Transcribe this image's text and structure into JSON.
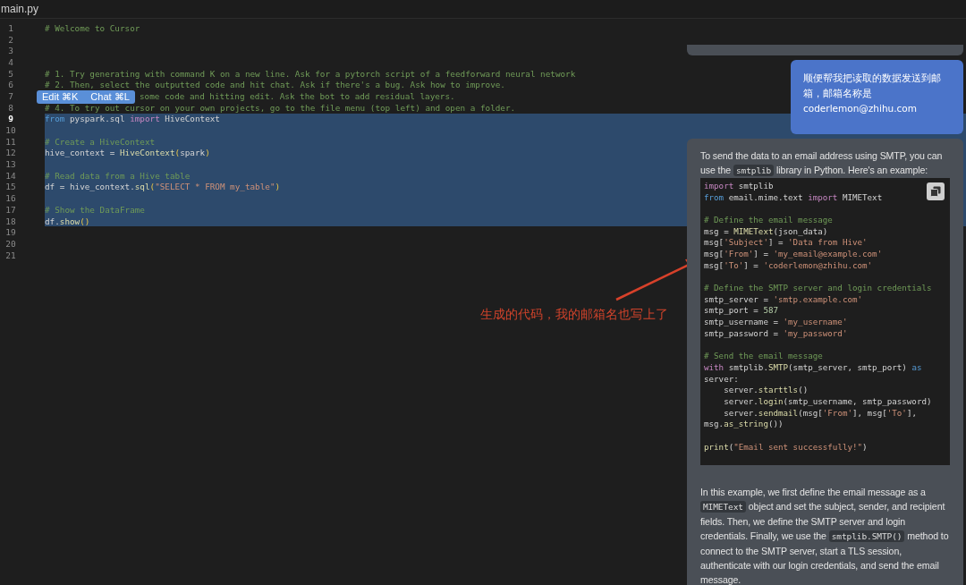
{
  "tab": {
    "title": "main.py"
  },
  "editor": {
    "lines": [
      {
        "number": "1",
        "current": false,
        "selected": false,
        "tokens": [
          {
            "text": "# Welcome to Cursor",
            "kind": "comment"
          }
        ]
      },
      {
        "number": "2",
        "current": false,
        "selected": false
      },
      {
        "number": "3",
        "current": false,
        "selected": false
      },
      {
        "number": "4",
        "current": false,
        "selected": false
      },
      {
        "number": "5",
        "current": false,
        "selected": false,
        "tokens": [
          {
            "text": "# 1. Try generating with command K on a new line. Ask for a pytorch script of a feedforward neural network",
            "kind": "comment"
          }
        ]
      },
      {
        "number": "6",
        "current": false,
        "selected": false,
        "tokens": [
          {
            "text": "# 2. Then, select the outputted code and hit chat. Ask if there's a bug. Ask how to improve.",
            "kind": "comment"
          }
        ]
      },
      {
        "number": "7",
        "current": false,
        "selected": false,
        "covered": true,
        "tokens": [
          {
            "text": "some code and hitting edit. Ask the bot to add residual layers.",
            "kind": "comment"
          }
        ]
      },
      {
        "number": "8",
        "current": false,
        "selected": false,
        "tokens": [
          {
            "text": "# 4. To try out cursor on your own projects, go to the file menu (top left) and open a folder.",
            "kind": "comment"
          }
        ]
      },
      {
        "number": "9",
        "current": true,
        "selected": true,
        "tokens": [
          {
            "text": "from ",
            "kind": "keyword2"
          },
          {
            "text": "pyspark.sql ",
            "kind": "plain"
          },
          {
            "text": "import ",
            "kind": "keyword"
          },
          {
            "text": "HiveContext",
            "kind": "plain"
          }
        ]
      },
      {
        "number": "10",
        "current": false,
        "selected": true
      },
      {
        "number": "11",
        "current": false,
        "selected": true,
        "tokens": [
          {
            "text": "# Create a HiveContext",
            "kind": "comment"
          }
        ]
      },
      {
        "number": "12",
        "current": false,
        "selected": true,
        "tokens": [
          {
            "text": "hive_context = ",
            "kind": "plain"
          },
          {
            "text": "HiveContext",
            "kind": "function"
          },
          {
            "text": "(",
            "kind": "paren"
          },
          {
            "text": "spark",
            "kind": "plain"
          },
          {
            "text": ")",
            "kind": "paren"
          }
        ]
      },
      {
        "number": "13",
        "current": false,
        "selected": true
      },
      {
        "number": "14",
        "current": false,
        "selected": true,
        "tokens": [
          {
            "text": "# Read data from a Hive table",
            "kind": "comment"
          }
        ]
      },
      {
        "number": "15",
        "current": false,
        "selected": true,
        "tokens": [
          {
            "text": "df = hive_context.",
            "kind": "plain"
          },
          {
            "text": "sql",
            "kind": "function"
          },
          {
            "text": "(",
            "kind": "paren"
          },
          {
            "text": "\"SELECT * FROM my_table\"",
            "kind": "string"
          },
          {
            "text": ")",
            "kind": "paren"
          }
        ]
      },
      {
        "number": "16",
        "current": false,
        "selected": true
      },
      {
        "number": "17",
        "current": false,
        "selected": true,
        "tokens": [
          {
            "text": "# Show the DataFrame",
            "kind": "comment"
          }
        ]
      },
      {
        "number": "18",
        "current": false,
        "selected": true,
        "tokens": [
          {
            "text": "df.",
            "kind": "plain"
          },
          {
            "text": "show",
            "kind": "function"
          },
          {
            "text": "()",
            "kind": "paren"
          }
        ]
      },
      {
        "number": "19",
        "current": false,
        "selected": false
      },
      {
        "number": "20",
        "current": false,
        "selected": false
      },
      {
        "number": "21",
        "current": false,
        "selected": false
      }
    ]
  },
  "popup": {
    "buttons": [
      "Edit ⌘K",
      "Chat ⌘L"
    ]
  },
  "annotation": {
    "text": "生成的代码，我的邮箱名也写上了"
  },
  "chat": {
    "user_message": "顺便帮我把读取的数据发送到邮箱，邮箱名称是coderlemon@zhihu.com",
    "reply_intro": [
      {
        "text": "To send the data to an email address using SMTP, you can use the ",
        "kind": "text"
      },
      {
        "text": "smtplib",
        "kind": "code"
      },
      {
        "text": " library in Python. Here's an example:",
        "kind": "text"
      }
    ],
    "code": [
      {
        "kind": "code",
        "tokens": [
          {
            "text": "import ",
            "kind": "keyword"
          },
          {
            "text": "smtplib",
            "kind": "plain"
          }
        ]
      },
      {
        "kind": "code",
        "tokens": [
          {
            "text": "from ",
            "kind": "keyword2"
          },
          {
            "text": "email.mime.text ",
            "kind": "plain"
          },
          {
            "text": "import ",
            "kind": "keyword"
          },
          {
            "text": "MIMEText",
            "kind": "plain"
          }
        ]
      },
      {
        "kind": "blank"
      },
      {
        "kind": "code",
        "tokens": [
          {
            "text": "# Define the email message",
            "kind": "comment"
          }
        ]
      },
      {
        "kind": "code",
        "tokens": [
          {
            "text": "msg = ",
            "kind": "plain"
          },
          {
            "text": "MIMEText",
            "kind": "function"
          },
          {
            "text": "(json_data)",
            "kind": "plain"
          }
        ]
      },
      {
        "kind": "code",
        "tokens": [
          {
            "text": "msg[",
            "kind": "plain"
          },
          {
            "text": "'Subject'",
            "kind": "string"
          },
          {
            "text": "] = ",
            "kind": "plain"
          },
          {
            "text": "'Data from Hive'",
            "kind": "string"
          }
        ]
      },
      {
        "kind": "code",
        "tokens": [
          {
            "text": "msg[",
            "kind": "plain"
          },
          {
            "text": "'From'",
            "kind": "string"
          },
          {
            "text": "] = ",
            "kind": "plain"
          },
          {
            "text": "'my_email@example.com'",
            "kind": "string"
          }
        ]
      },
      {
        "kind": "code",
        "tokens": [
          {
            "text": "msg[",
            "kind": "plain"
          },
          {
            "text": "'To'",
            "kind": "string"
          },
          {
            "text": "] = ",
            "kind": "plain"
          },
          {
            "text": "'coderlemon@zhihu.com'",
            "kind": "string"
          }
        ]
      },
      {
        "kind": "blank"
      },
      {
        "kind": "code",
        "tokens": [
          {
            "text": "# Define the SMTP server and login credentials",
            "kind": "comment"
          }
        ]
      },
      {
        "kind": "code",
        "tokens": [
          {
            "text": "smtp_server = ",
            "kind": "plain"
          },
          {
            "text": "'smtp.example.com'",
            "kind": "string"
          }
        ]
      },
      {
        "kind": "code",
        "tokens": [
          {
            "text": "smtp_port = ",
            "kind": "plain"
          },
          {
            "text": "587",
            "kind": "number"
          }
        ]
      },
      {
        "kind": "code",
        "tokens": [
          {
            "text": "smtp_username = ",
            "kind": "plain"
          },
          {
            "text": "'my_username'",
            "kind": "string"
          }
        ]
      },
      {
        "kind": "code",
        "tokens": [
          {
            "text": "smtp_password = ",
            "kind": "plain"
          },
          {
            "text": "'my_password'",
            "kind": "string"
          }
        ]
      },
      {
        "kind": "blank"
      },
      {
        "kind": "code",
        "tokens": [
          {
            "text": "# Send the email message",
            "kind": "comment"
          }
        ]
      },
      {
        "kind": "code",
        "tokens": [
          {
            "text": "with ",
            "kind": "keyword"
          },
          {
            "text": "smtplib.",
            "kind": "plain"
          },
          {
            "text": "SMTP",
            "kind": "function"
          },
          {
            "text": "(smtp_server, smtp_port) ",
            "kind": "plain"
          },
          {
            "text": "as",
            "kind": "keyword2"
          }
        ]
      },
      {
        "kind": "code",
        "tokens": [
          {
            "text": "server:",
            "kind": "plain"
          }
        ]
      },
      {
        "kind": "code",
        "tokens": [
          {
            "text": "    server.",
            "kind": "plain"
          },
          {
            "text": "starttls",
            "kind": "function"
          },
          {
            "text": "()",
            "kind": "plain"
          }
        ]
      },
      {
        "kind": "code",
        "tokens": [
          {
            "text": "    server.",
            "kind": "plain"
          },
          {
            "text": "login",
            "kind": "function"
          },
          {
            "text": "(smtp_username, smtp_password)",
            "kind": "plain"
          }
        ]
      },
      {
        "kind": "code",
        "tokens": [
          {
            "text": "    server.",
            "kind": "plain"
          },
          {
            "text": "sendmail",
            "kind": "function"
          },
          {
            "text": "(msg[",
            "kind": "plain"
          },
          {
            "text": "'From'",
            "kind": "string"
          },
          {
            "text": "], msg[",
            "kind": "plain"
          },
          {
            "text": "'To'",
            "kind": "string"
          },
          {
            "text": "],",
            "kind": "plain"
          }
        ]
      },
      {
        "kind": "code",
        "tokens": [
          {
            "text": "msg.",
            "kind": "plain"
          },
          {
            "text": "as_string",
            "kind": "function"
          },
          {
            "text": "())",
            "kind": "plain"
          }
        ]
      },
      {
        "kind": "blank"
      },
      {
        "kind": "code",
        "tokens": [
          {
            "text": "print",
            "kind": "function"
          },
          {
            "text": "(",
            "kind": "plain"
          },
          {
            "text": "\"Email sent successfully!\"",
            "kind": "string"
          },
          {
            "text": ")",
            "kind": "plain"
          }
        ]
      }
    ],
    "reply_outro": [
      {
        "text": "In this example, we first define the email message as a ",
        "kind": "text"
      },
      {
        "text": "MIMEText",
        "kind": "code"
      },
      {
        "text": " object and set the subject, sender, and recipient fields. Then, we define the SMTP server and login credentials. Finally, we use the ",
        "kind": "text"
      },
      {
        "text": "smtplib.SMTP()",
        "kind": "code"
      },
      {
        "text": " method to connect to the SMTP server, start a TLS session, authenticate with our login credentials, and send the email message.",
        "kind": "text"
      }
    ]
  }
}
